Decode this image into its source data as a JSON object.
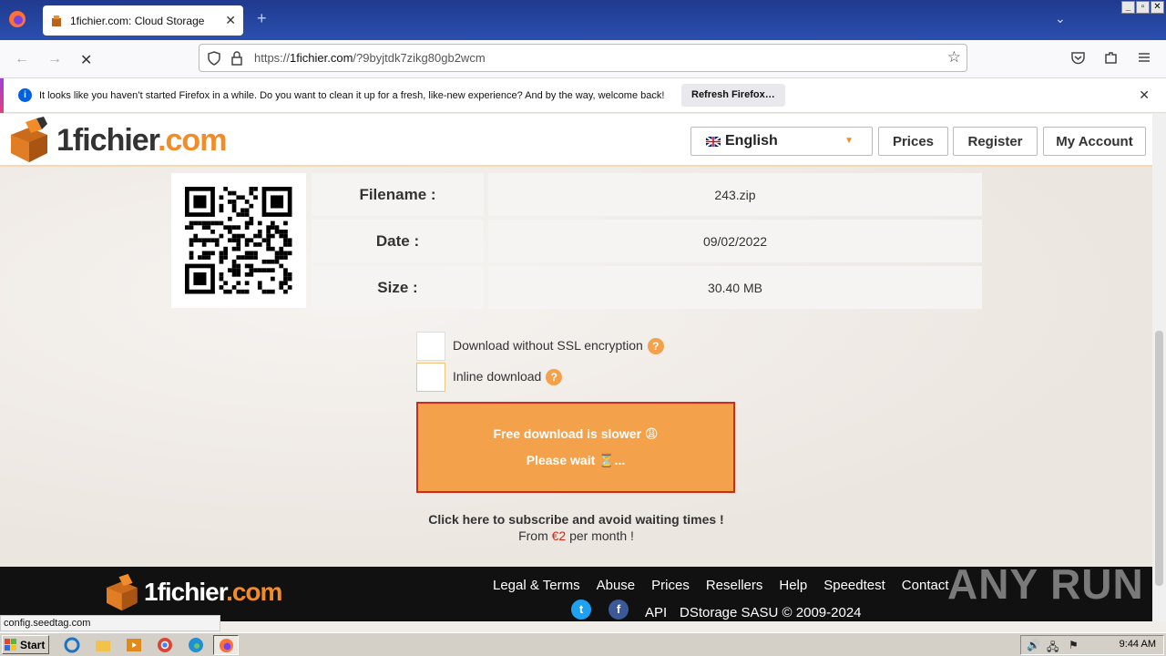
{
  "browser": {
    "tab_title": "1fichier.com: Cloud Storage",
    "url_prefix": "https://",
    "url_host": "1fichier.com",
    "url_path": "/?9byjtdk7zikg80gb2wcm",
    "notice_message": "It looks like you haven’t started Firefox in a while. Do you want to clean it up for a fresh, like-new experience? And by the way, welcome back!",
    "refresh_label": "Refresh Firefox…",
    "status_text": "config.seedtag.com"
  },
  "header": {
    "logo_main": "1fichier",
    "logo_tld": ".com",
    "language": "English",
    "prices": "Prices",
    "register": "Register",
    "account": "My Account"
  },
  "file": {
    "filename_label": "Filename :",
    "filename": "243.zip",
    "date_label": "Date :",
    "date": "09/02/2022",
    "size_label": "Size :",
    "size": "30.40 MB"
  },
  "options": {
    "no_ssl": "Download without SSL encryption",
    "inline": "Inline download",
    "help": "?"
  },
  "download": {
    "line1": "Free download is slower 😩",
    "line2": "Please wait ⏳..."
  },
  "subscribe": {
    "headline": "Click here to subscribe and avoid waiting times !",
    "from": "From",
    "price": "€2",
    "per_month": "per month !"
  },
  "footer": {
    "logo_main": "1fichier",
    "logo_tld": ".com",
    "links": [
      "Legal & Terms",
      "Abuse",
      "Prices",
      "Resellers",
      "Help",
      "Speedtest",
      "Contact"
    ],
    "api": "API",
    "copyright": "DStorage SASU © 2009-2024"
  },
  "watermark": "ANY RUN",
  "taskbar": {
    "start": "Start",
    "clock": "9:44 AM"
  },
  "colors": {
    "brand_orange": "#f4a14b",
    "alert_red": "#d12a1a",
    "firefox_blue": "#2b4fae"
  }
}
